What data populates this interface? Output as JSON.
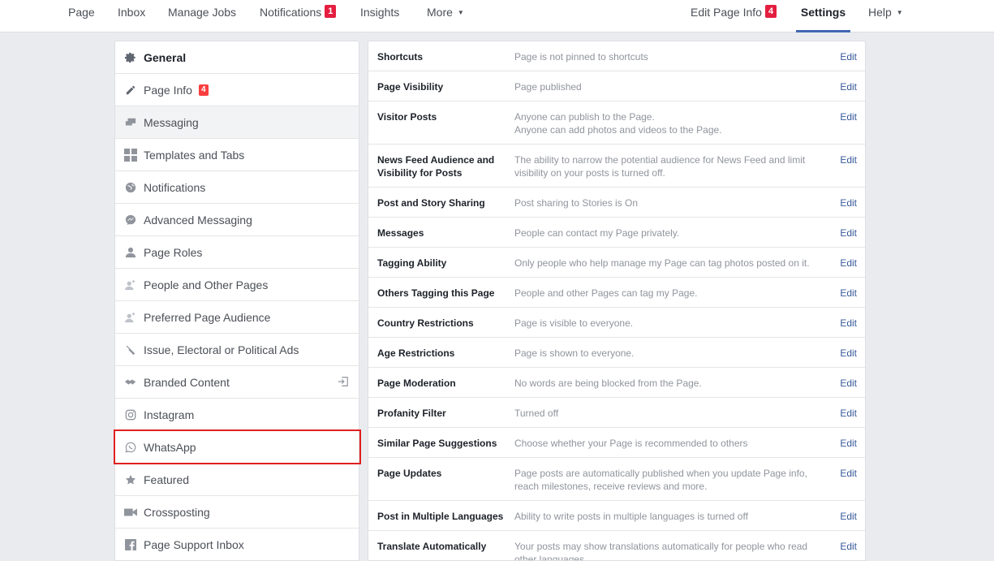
{
  "topnav": {
    "left_items": [
      "Page",
      "Inbox",
      "Manage Jobs",
      "Notifications",
      "Insights",
      "More"
    ],
    "notifications_badge": "1",
    "more_caret": "▼",
    "edit_page_info": "Edit Page Info",
    "edit_page_info_badge": "4",
    "settings": "Settings",
    "help": "Help",
    "help_caret": "▼",
    "colors": {
      "badge": "#e41e3f",
      "active_underline": "#4267b2"
    }
  },
  "sidebar": {
    "items": [
      {
        "label": "General",
        "icon": "gear-icon"
      },
      {
        "label": "Page Info",
        "icon": "pencil-icon",
        "badge": "4"
      },
      {
        "label": "Messaging",
        "icon": "chat-bubbles-icon"
      },
      {
        "label": "Templates and Tabs",
        "icon": "grid-icon"
      },
      {
        "label": "Notifications",
        "icon": "globe-icon"
      },
      {
        "label": "Advanced Messaging",
        "icon": "messenger-icon"
      },
      {
        "label": "Page Roles",
        "icon": "person-icon"
      },
      {
        "label": "People and Other Pages",
        "icon": "person-add-icon"
      },
      {
        "label": "Preferred Page Audience",
        "icon": "person-add-icon"
      },
      {
        "label": "Issue, Electoral or Political Ads",
        "icon": "wrench-icon"
      },
      {
        "label": "Branded Content",
        "icon": "handshake-icon",
        "right_icon": "login-icon"
      },
      {
        "label": "Instagram",
        "icon": "instagram-icon"
      },
      {
        "label": "WhatsApp",
        "icon": "whatsapp-icon"
      },
      {
        "label": "Featured",
        "icon": "star-icon"
      },
      {
        "label": "Crossposting",
        "icon": "video-camera-icon"
      },
      {
        "label": "Page Support Inbox",
        "icon": "facebook-icon"
      }
    ],
    "highlight_color": "#e02020"
  },
  "settings": {
    "edit_label": "Edit",
    "rows": [
      {
        "label": "Shortcuts",
        "desc": [
          "Page is not pinned to shortcuts"
        ]
      },
      {
        "label": "Page Visibility",
        "desc": [
          "Page published"
        ]
      },
      {
        "label": "Visitor Posts",
        "desc": [
          "Anyone can publish to the Page.",
          "Anyone can add photos and videos to the Page."
        ]
      },
      {
        "label": "News Feed Audience and Visibility for Posts",
        "desc": [
          "The ability to narrow the potential audience for News Feed and limit visibility on your posts is turned off."
        ]
      },
      {
        "label": "Post and Story Sharing",
        "desc": [
          "Post sharing to Stories is On"
        ]
      },
      {
        "label": "Messages",
        "desc": [
          "People can contact my Page privately."
        ]
      },
      {
        "label": "Tagging Ability",
        "desc": [
          "Only people who help manage my Page can tag photos posted on it."
        ]
      },
      {
        "label": "Others Tagging this Page",
        "desc": [
          "People and other Pages can tag my Page."
        ]
      },
      {
        "label": "Country Restrictions",
        "desc": [
          "Page is visible to everyone."
        ]
      },
      {
        "label": "Age Restrictions",
        "desc": [
          "Page is shown to everyone."
        ]
      },
      {
        "label": "Page Moderation",
        "desc": [
          "No words are being blocked from the Page."
        ]
      },
      {
        "label": "Profanity Filter",
        "desc": [
          "Turned off"
        ]
      },
      {
        "label": "Similar Page Suggestions",
        "desc": [
          "Choose whether your Page is recommended to others"
        ]
      },
      {
        "label": "Page Updates",
        "desc": [
          "Page posts are automatically published when you update Page info, reach milestones, receive reviews and more."
        ]
      },
      {
        "label": "Post in Multiple Languages",
        "desc": [
          "Ability to write posts in multiple languages is turned off"
        ]
      },
      {
        "label": "Translate Automatically",
        "desc": [
          "Your posts may show translations automatically for people who read other languages."
        ]
      }
    ]
  }
}
